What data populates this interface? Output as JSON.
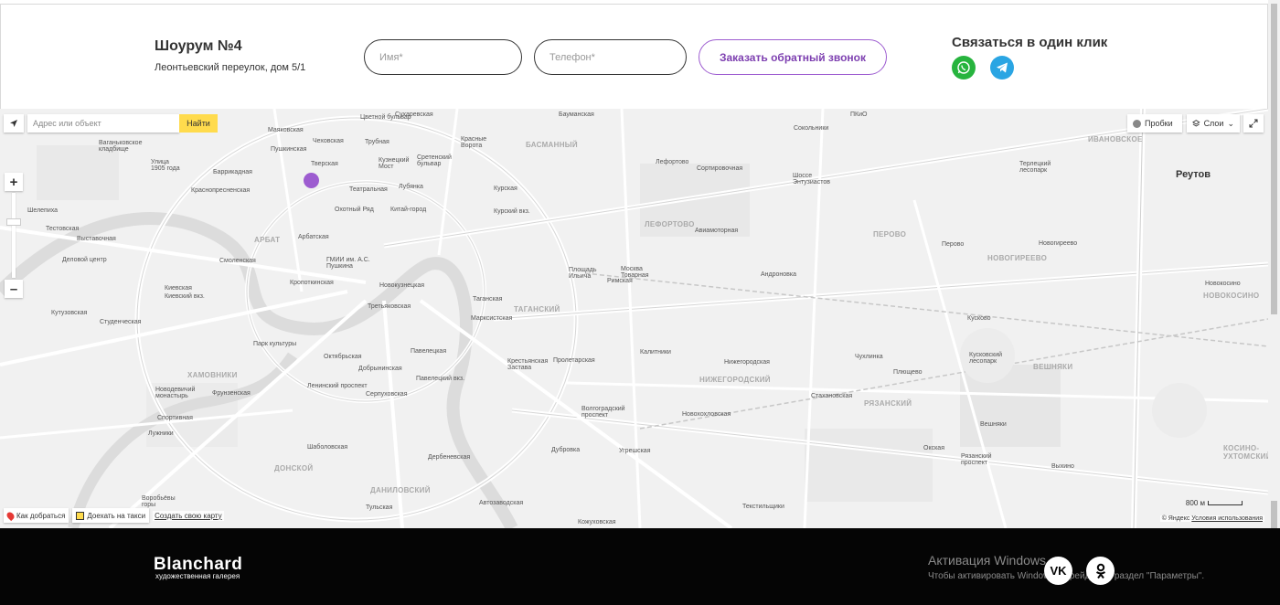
{
  "contact": {
    "title": "Шоурум №4",
    "address": "Леонтьевский переулок, дом 5/1",
    "name_placeholder": "Имя*",
    "phone_placeholder": "Телефон*",
    "callback_label": "Заказать обратный звонок",
    "one_click_title": "Связаться в один клик",
    "icons": {
      "whatsapp": "whatsapp-icon",
      "telegram": "telegram-icon"
    },
    "colors": {
      "accent": "#9d5cd0",
      "whatsapp": "#27b43e",
      "telegram": "#2aa5e3"
    }
  },
  "map": {
    "search_placeholder": "Адрес или объект",
    "search_button": "Найти",
    "traffic_label": "Пробки",
    "layers_label": "Слои",
    "route_label": "Как добраться",
    "taxi_label": "Доехать на такси",
    "create_map_label": "Создать свою карту",
    "scale_label": "800 м",
    "copyright": "© Яндекс",
    "terms_label": "Условия использования",
    "city_label": "Реутов",
    "districts": [
      "БАСМАННЫЙ",
      "ЛЕФОРТОВО",
      "ТАГАНСКИЙ",
      "ХАМОВНИКИ",
      "НИЖЕГОРОДСКИЙ",
      "ДОНСКОЙ",
      "ДАНИЛОВСКИЙ",
      "ПЕРОВО",
      "НОВОГИРЕЕВО",
      "ВЕШНЯКИ",
      "РЯЗАНСКИЙ",
      "АРБАТ",
      "ИВАНОВСКОЕ",
      "НОВОКОСИНО",
      "КОСИНО-УХТОМСКИЙ"
    ],
    "labels": [
      "Цветной бульвар",
      "Сухаревская",
      "Бауманская",
      "Маяковская",
      "Чеховская",
      "Тверская",
      "Пушкинская",
      "Трубная",
      "Сретенский бульвар",
      "Красные Ворота",
      "Кузнецкий Мост",
      "Лубянка",
      "Театральная",
      "Охотный Ряд",
      "Китай-город",
      "Курская",
      "Курский вкз.",
      "Баррикадная",
      "Краснопресненская",
      "Улица 1905 года",
      "Смоленская",
      "Арбатская",
      "ГМИИ им. А.С. Пушкина",
      "Кропоткинская",
      "Новокузнецкая",
      "Третьяковская",
      "Таганская",
      "Марксистская",
      "Площадь Ильича",
      "Римская",
      "Москва Товарная",
      "Авиамоторная",
      "Андроновка",
      "Лефортово",
      "Сортировочная",
      "Шоссе Энтузиастов",
      "Перово",
      "Новогиреево",
      "Новокосино",
      "Кусково",
      "Кусковский лесопарк",
      "Киевская",
      "Киевский вкз.",
      "Студенческая",
      "Кутузовская",
      "Парк культуры",
      "Октябрьская",
      "Добрынинская",
      "Серпуховская",
      "Павелецкая",
      "Павелецкий вкз.",
      "Крестьянская Застава",
      "Пролетарская",
      "Волгоградский проспект",
      "Новохохловская",
      "Калитники",
      "Нижегородская",
      "Стахановская",
      "Чухлинка",
      "Плющево",
      "Вешняки",
      "Окская",
      "Рязанский проспект",
      "Выхино",
      "Шаболовская",
      "Ленинский проспект",
      "Дербеневская",
      "Дубровка",
      "Угрешская",
      "Текстильщики",
      "Автозаводская",
      "Тульская",
      "Кожуховская",
      "Фрунзенская",
      "Спортивная",
      "Лужники",
      "Новодевичий монастырь",
      "Воробьёвы горы",
      "Выставочная",
      "Деловой центр",
      "Тестовская",
      "Шелепиха",
      "Ваганьковское кладбище",
      "Терлецкий лесопарк",
      "Сокольники",
      "ПКиО"
    ],
    "marker_color": "#9d5cd0"
  },
  "footer": {
    "logo": "Blanchard",
    "logo_sub": "художественная галерея",
    "activation_title": "Активация Windows",
    "activation_text": "Чтобы активировать Windows, перейдите в раздел \"Параметры\".",
    "vk_label": "VK",
    "icons": {
      "vk": "vk-icon",
      "ok": "odnoklassniki-icon"
    }
  }
}
